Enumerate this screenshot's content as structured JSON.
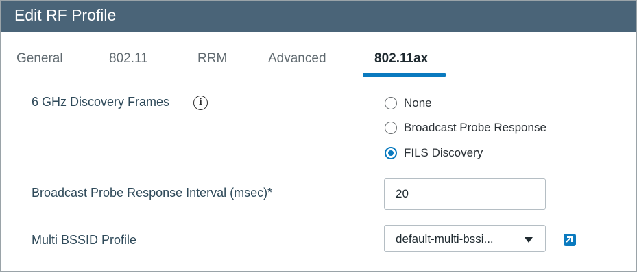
{
  "dialog": {
    "title": "Edit RF Profile"
  },
  "tabs": [
    {
      "label": "General"
    },
    {
      "label": "802.11"
    },
    {
      "label": "RRM"
    },
    {
      "label": "Advanced"
    },
    {
      "label": "802.11ax"
    }
  ],
  "active_tab": "802.11ax",
  "discovery": {
    "label": "6 GHz Discovery Frames",
    "info_icon_glyph": "i",
    "options": [
      {
        "label": "None",
        "checked": false
      },
      {
        "label": "Broadcast Probe Response",
        "checked": false
      },
      {
        "label": "FILS Discovery",
        "checked": true
      }
    ]
  },
  "probe_interval": {
    "label": "Broadcast Probe Response Interval (msec)*",
    "value": "20"
  },
  "bssid_profile": {
    "label": "Multi BSSID Profile",
    "selected": "default-multi-bssi..."
  },
  "colors": {
    "titlebar": "#4a6478",
    "accent": "#0a7abf",
    "label_text": "#2f4a5a"
  },
  "icons": {
    "info": "info-circle-icon",
    "dropdown": "caret-down-icon",
    "edit": "edit-link-icon"
  }
}
